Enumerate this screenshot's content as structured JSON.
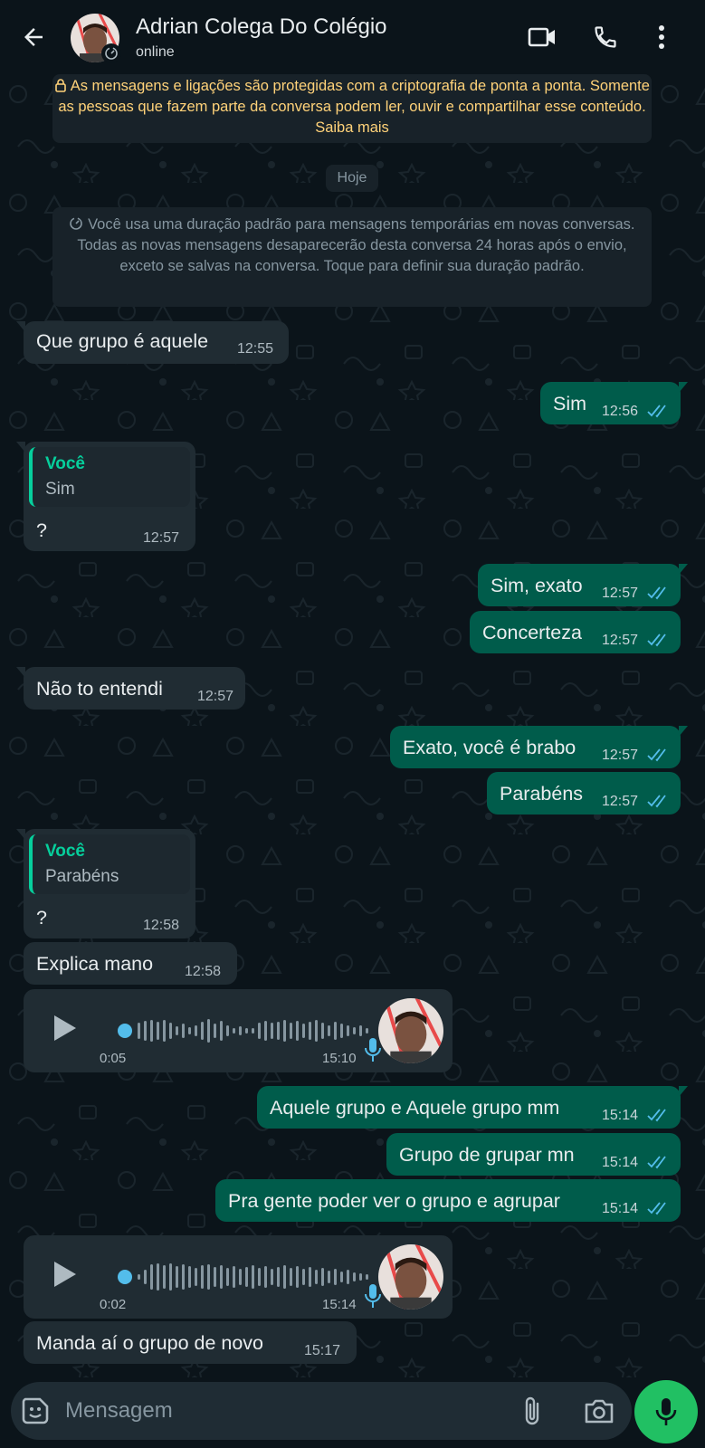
{
  "header": {
    "contact_name": "Adrian Colega Do Colégio",
    "status": "online",
    "icons": [
      "back-arrow-icon",
      "video-call-icon",
      "phone-icon",
      "more-vertical-icon"
    ]
  },
  "system": {
    "encryption_notice": "As mensagens e ligações são protegidas com a criptografia de ponta a ponta. Somente as pessoas que fazem parte da conversa podem ler, ouvir e compartilhar esse conteúdo. Saiba mais",
    "date_chip": "Hoje",
    "temporary_notice": "Você usa uma duração padrão para mensagens temporárias em novas conversas. Todas as novas mensagens desaparecerão desta conversa 24 horas após o envio, exceto se salvas na conversa. Toque para definir sua duração padrão."
  },
  "messages": [
    {
      "dir": "in",
      "text": "Que grupo é aquele",
      "time": "12:55"
    },
    {
      "dir": "out",
      "text": "Sim",
      "time": "12:56",
      "read": true
    },
    {
      "dir": "in",
      "quote_author": "Você",
      "quote_text": "Sim",
      "text": "?",
      "time": "12:57"
    },
    {
      "dir": "out",
      "text": "Sim, exato",
      "time": "12:57",
      "read": true
    },
    {
      "dir": "out",
      "text": "Concerteza",
      "time": "12:57",
      "read": true
    },
    {
      "dir": "in",
      "text": "Não to entendi",
      "time": "12:57"
    },
    {
      "dir": "out",
      "text": "Exato, você é brabo",
      "time": "12:57",
      "read": true
    },
    {
      "dir": "out",
      "text": "Parabéns",
      "time": "12:57",
      "read": true
    },
    {
      "dir": "in",
      "quote_author": "Você",
      "quote_text": "Parabéns",
      "text": "?",
      "time": "12:58"
    },
    {
      "dir": "in",
      "text": "Explica mano",
      "time": "12:58"
    },
    {
      "dir": "in",
      "type": "voice",
      "duration": "0:05",
      "time": "15:10"
    },
    {
      "dir": "out",
      "text": "Aquele grupo e Aquele grupo mm",
      "time": "15:14",
      "read": true
    },
    {
      "dir": "out",
      "text": "Grupo de grupar mn",
      "time": "15:14",
      "read": true
    },
    {
      "dir": "out",
      "text": "Pra gente poder ver o grupo e agrupar",
      "time": "15:14",
      "read": true
    },
    {
      "dir": "in",
      "type": "voice",
      "duration": "0:02",
      "time": "15:14"
    },
    {
      "dir": "in",
      "text": "Manda aí o grupo de novo",
      "time": "15:17"
    }
  ],
  "input": {
    "placeholder": "Mensagem",
    "icons": [
      "emoji-icon",
      "attach-icon",
      "camera-icon",
      "mic-icon"
    ]
  },
  "colors": {
    "background": "#0b141a",
    "incoming_bubble": "#202c33",
    "outgoing_bubble": "#005c4b",
    "accent_green": "#21c063",
    "read_ticks": "#53bdeb",
    "encryption_text": "#ffd279"
  }
}
